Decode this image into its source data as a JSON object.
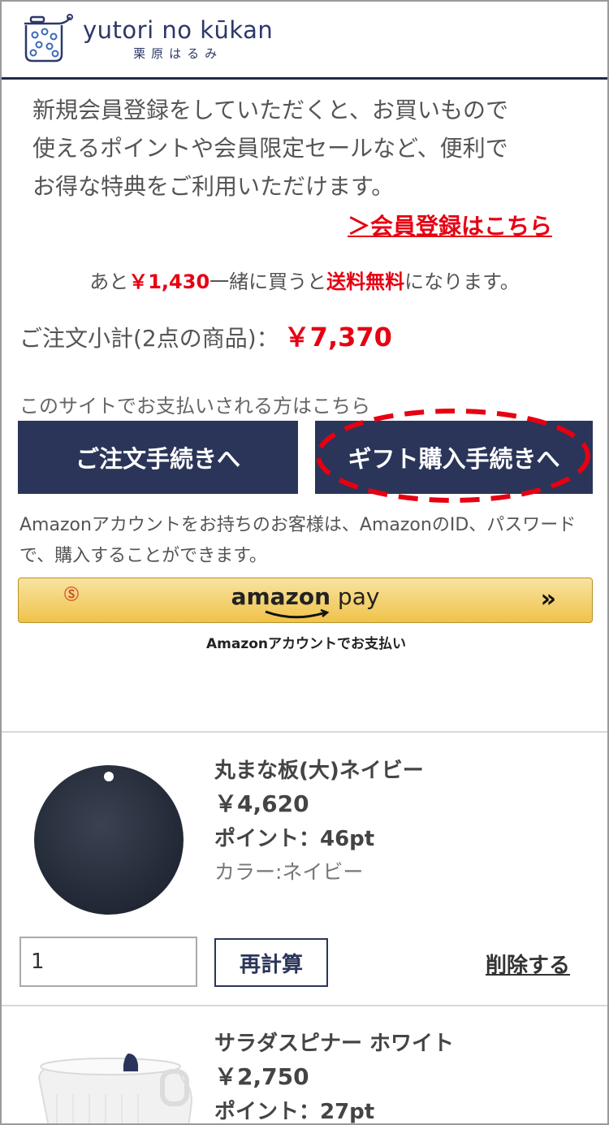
{
  "header": {
    "logo_main": "yutori no kūkan",
    "logo_sub": "栗原はるみ"
  },
  "intro": {
    "text": "新規会員登録をしていただくと、お買いものでお使えるポイントや会員限定セールなど、便利でお得な特典をご利用いただけます。",
    "lines": [
      "新規会員登録をしていただくと、お買いもので",
      "使えるポイントや会員限定セールなど、便利で",
      "お得な特典をご利用いただけます。"
    ],
    "register_link": "＞会員登録はこちら"
  },
  "shipping": {
    "prefix": "あと",
    "amount": "￥1,430",
    "middle": "一緒に買うと",
    "free": "送料無料",
    "suffix": "になります。"
  },
  "subtotal": {
    "label": "ご注文小計(2点の商品)：",
    "price": "￥7,370"
  },
  "payment": {
    "note": "このサイトでお支払いされる方はこちら",
    "order_button": "ご注文手続きへ",
    "gift_button": "ギフト購入手続きへ",
    "amazon_note": "Amazonアカウントをお持ちのお客様は、AmazonのID、パスワードで、購入することができます。",
    "amazon_logo_bold": "amazon",
    "amazon_logo_light": " pay",
    "amazon_arrows": "»",
    "amazon_s": "Ⓢ",
    "amazon_caption": "Amazonアカウントでお支払い"
  },
  "items": [
    {
      "name": "丸まな板(大)ネイビー",
      "price": "￥4,620",
      "points": "ポイント：46pt",
      "color": "カラー:ネイビー",
      "quantity": "1",
      "recalc_label": "再計算",
      "delete_label": "削除する"
    },
    {
      "name": "サラダスピナー ホワイト",
      "price": "￥2,750",
      "points": "ポイント：27pt"
    }
  ],
  "colors": {
    "navy": "#2a3559",
    "red": "#e60012",
    "amazon_yellow": "#f0c24a"
  }
}
